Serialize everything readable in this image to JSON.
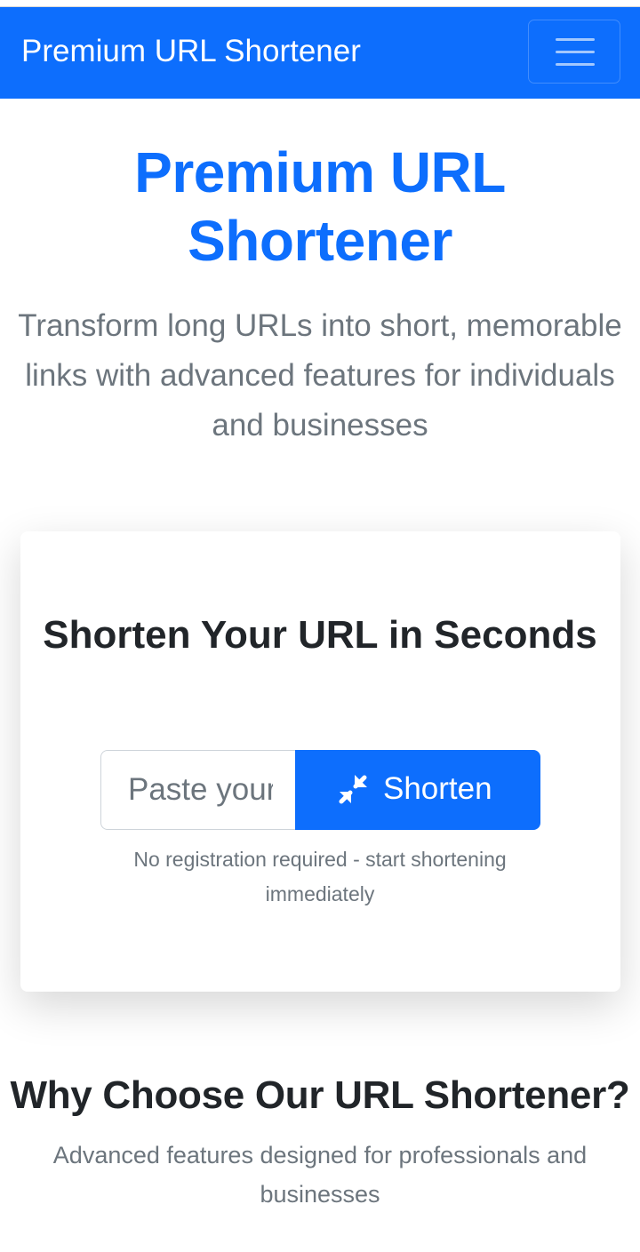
{
  "navbar": {
    "brand": "Premium URL Shortener",
    "toggler_icon": "hamburger-menu-icon",
    "background": "#0d6efd"
  },
  "hero": {
    "title": "Premium URL Shortener",
    "subtitle": "Transform long URLs into short, memorable links with advanced features for individuals and businesses"
  },
  "shortener_card": {
    "title": "Shorten Your URL in Seconds",
    "input_placeholder": "Paste your long URL here...",
    "input_value": "",
    "button_label": "Shorten",
    "button_icon": "compress-arrows-icon",
    "helper_text": "No registration required - start shortening immediately"
  },
  "features_section": {
    "title": "Why Choose Our URL Shortener?",
    "subtitle": "Advanced features designed for professionals and businesses"
  },
  "colors": {
    "primary": "#0d6efd",
    "muted_text": "#6c757d",
    "body_text": "#212529"
  }
}
